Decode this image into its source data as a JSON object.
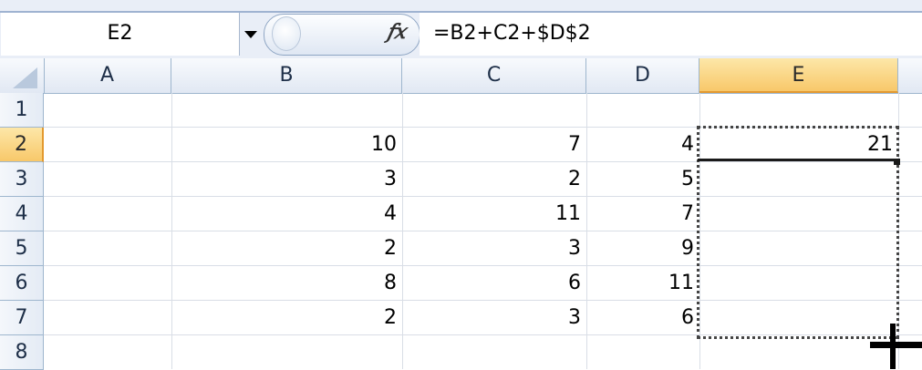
{
  "formula_bar": {
    "name_box": "E2",
    "fx_label": "fx",
    "formula": "=B2+C2+$D$2"
  },
  "columns": [
    "A",
    "B",
    "C",
    "D",
    "E"
  ],
  "active_column": "E",
  "rows": [
    "1",
    "2",
    "3",
    "4",
    "5",
    "6",
    "7",
    "8"
  ],
  "active_row": "2",
  "cells": {
    "B2": "10",
    "C2": "7",
    "D2": "4",
    "E2": "21",
    "B3": "3",
    "C3": "2",
    "D3": "5",
    "B4": "4",
    "C4": "11",
    "D4": "7",
    "B5": "2",
    "C5": "3",
    "D5": "9",
    "B6": "8",
    "C6": "6",
    "D6": "11",
    "B7": "2",
    "C7": "3",
    "D7": "6"
  },
  "selection": {
    "active_cell": "E2",
    "copy_range": "E2:E7"
  },
  "colors": {
    "header_active": "#f8c86a",
    "header_bg": "#e1e8f3",
    "gridline": "#d9dee6"
  }
}
